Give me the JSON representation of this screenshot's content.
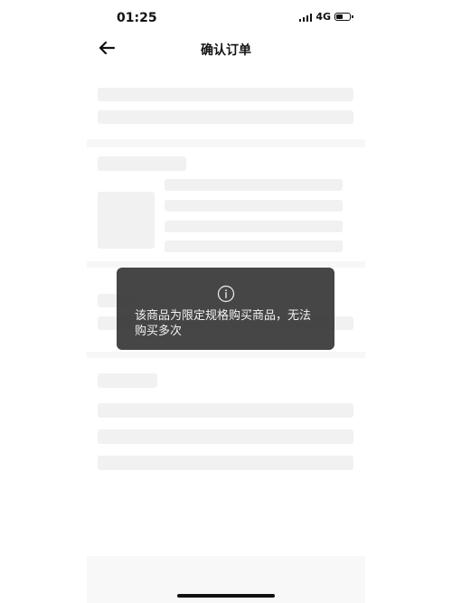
{
  "status_bar": {
    "time": "01:25",
    "network": "4G",
    "battery_level": 0.55
  },
  "nav": {
    "back_icon": "arrow-left-icon",
    "title": "确认订单"
  },
  "toast": {
    "icon": "info-icon",
    "message": "该商品为限定规格购买商品，无法购买多次"
  },
  "colors": {
    "toast_bg": "#383838",
    "skeleton": "#ececec"
  }
}
